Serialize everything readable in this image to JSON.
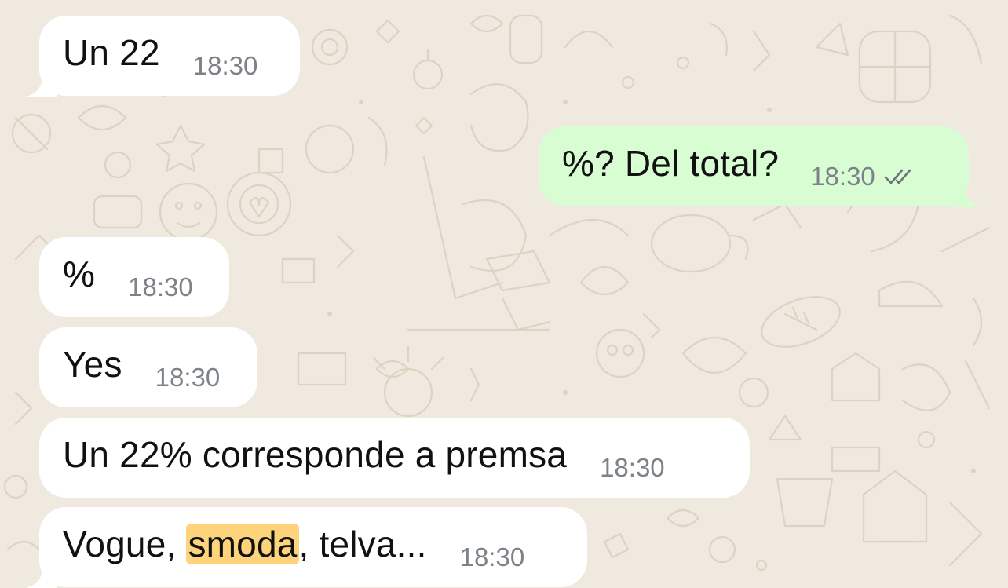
{
  "colors": {
    "wallpaper": "#efe9df",
    "incoming_bubble": "#ffffff",
    "outgoing_bubble": "#d9fdd3",
    "timestamp": "#7d8287",
    "read_ticks": "#6b7478",
    "search_highlight": "#fdd37b"
  },
  "messages": [
    {
      "direction": "incoming",
      "text": "Un 22",
      "time": "18:30"
    },
    {
      "direction": "outgoing",
      "text": "%? Del total?",
      "time": "18:30",
      "status_icon": "double-check-icon"
    },
    {
      "direction": "incoming",
      "text": "%",
      "time": "18:30"
    },
    {
      "direction": "incoming",
      "text": "Yes",
      "time": "18:30"
    },
    {
      "direction": "incoming",
      "text": "Un 22% corresponde a premsa",
      "time": "18:30"
    },
    {
      "direction": "incoming",
      "text_before": "Vogue, ",
      "highlighted": "smoda",
      "text_after": ", telva...",
      "time": "18:30"
    }
  ]
}
